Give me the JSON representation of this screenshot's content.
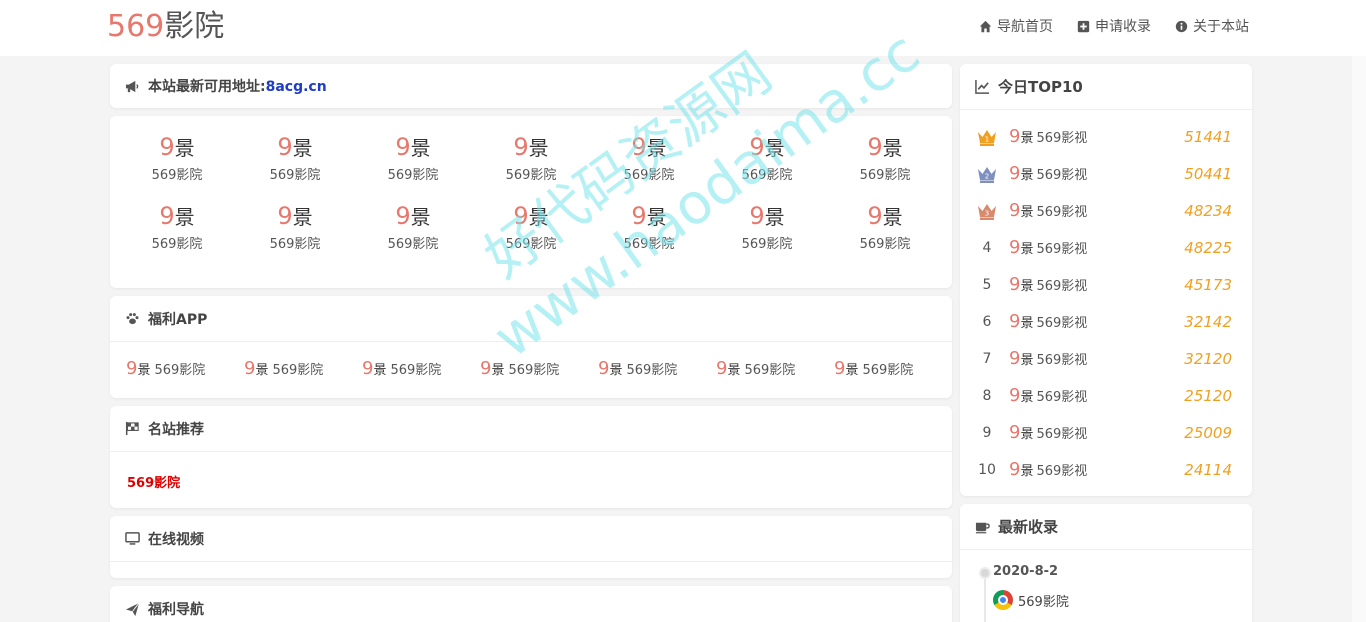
{
  "header": {
    "logo_num": "569",
    "logo_text": "影院",
    "nav": [
      {
        "label": "导航首页",
        "icon": "home-icon"
      },
      {
        "label": "申请收录",
        "icon": "plus-square-icon"
      },
      {
        "label": "关于本站",
        "icon": "info-circle-icon"
      }
    ]
  },
  "notice": {
    "icon": "megaphone-icon",
    "text": "本站最新可用地址:",
    "link": "8acg.cn"
  },
  "mini_logo": {
    "num": "9",
    "char": "景"
  },
  "grid": {
    "rows": [
      [
        "569影院",
        "569影院",
        "569影院",
        "569影院",
        "569影院",
        "569影院",
        "569影院"
      ],
      [
        "569影院",
        "569影院",
        "569影院",
        "569影院",
        "569影院",
        "569影院",
        "569影院"
      ]
    ]
  },
  "app_section": {
    "title": "福利APP",
    "icon": "paw-icon",
    "items": [
      "569影院",
      "569影院",
      "569影院",
      "569影院",
      "569影院",
      "569影院",
      "569影院"
    ]
  },
  "famous_section": {
    "title": "名站推荐",
    "icon": "flag-checkered-icon",
    "link": "569影院",
    "link_color": "#dd0000"
  },
  "video_section": {
    "title": "在线视频",
    "icon": "monitor-icon"
  },
  "welfare_section": {
    "title": "福利导航",
    "icon": "paper-plane-icon"
  },
  "top10": {
    "title": "今日TOP10",
    "icon": "line-chart-icon",
    "items": [
      {
        "rank": "1",
        "name": "569影视",
        "count": "51441",
        "icon": "gold-crown-icon"
      },
      {
        "rank": "2",
        "name": "569影视",
        "count": "50441",
        "icon": "silver-crown-icon"
      },
      {
        "rank": "3",
        "name": "569影视",
        "count": "48234",
        "icon": "bronze-crown-icon"
      },
      {
        "rank": "4",
        "name": "569影视",
        "count": "48225"
      },
      {
        "rank": "5",
        "name": "569影视",
        "count": "45173"
      },
      {
        "rank": "6",
        "name": "569影视",
        "count": "32142"
      },
      {
        "rank": "7",
        "name": "569影视",
        "count": "32120"
      },
      {
        "rank": "8",
        "name": "569影视",
        "count": "25120"
      },
      {
        "rank": "9",
        "name": "569影视",
        "count": "25009"
      },
      {
        "rank": "10",
        "name": "569影视",
        "count": "24114"
      }
    ]
  },
  "newest": {
    "title": "最新收录",
    "icon": "coffee-cup-icon",
    "date": "2020-8-2",
    "item": "569影院",
    "item_icon": "chrome-icon"
  },
  "watermark": {
    "line1": "好代码资源网",
    "line2": "www.haodaima.cc"
  },
  "colors": {
    "logo_accent": "#e8776c",
    "link_blue": "#1e3cc8",
    "count_orange": "#f0a020",
    "watermark": "#78e6eb"
  }
}
